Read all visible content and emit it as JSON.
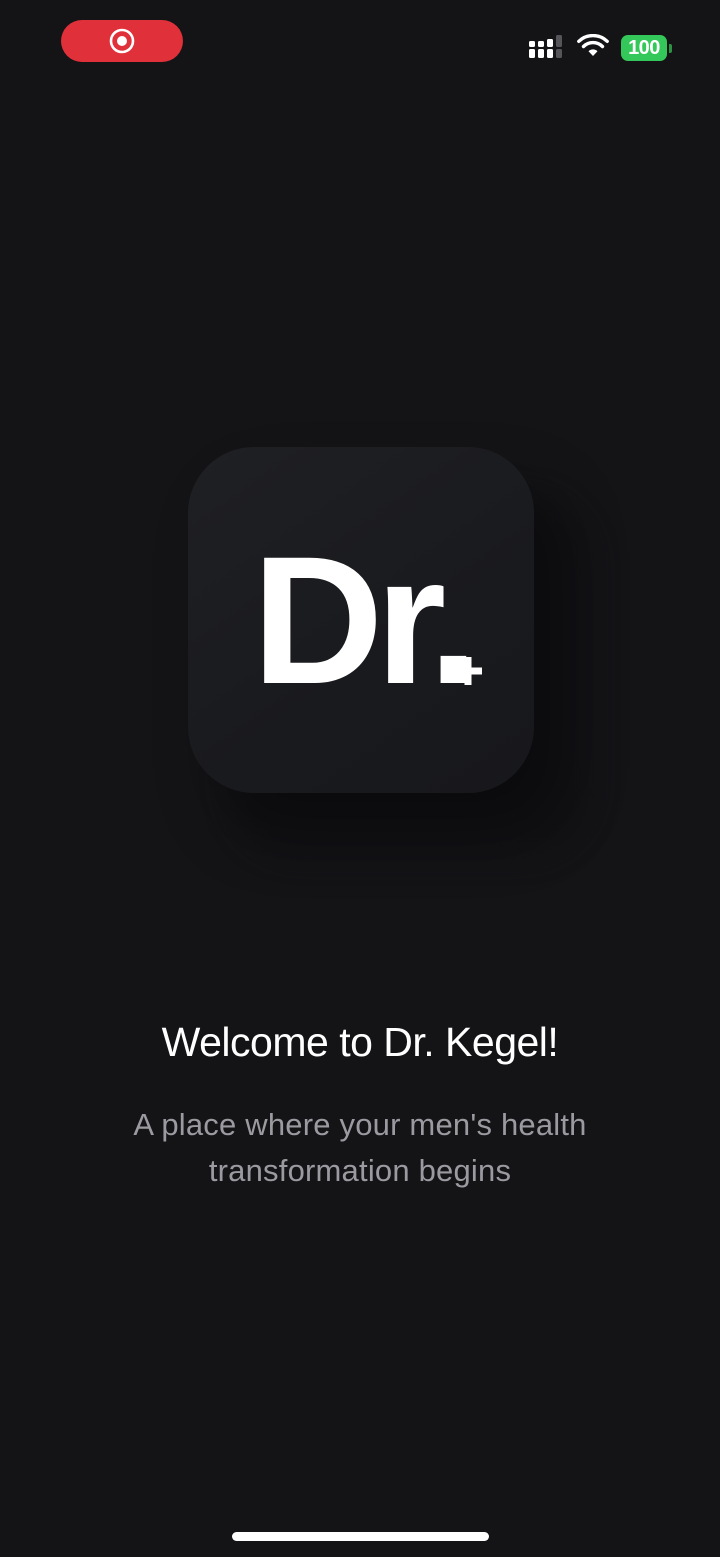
{
  "status_bar": {
    "battery_level": "100",
    "recording_color": "#e0303a",
    "battery_color": "#34c759",
    "icons": [
      "record-icon",
      "cellular-signal-icon",
      "wifi-icon",
      "battery-icon"
    ]
  },
  "logo": {
    "text": "Dr.",
    "badge": "+"
  },
  "welcome": {
    "title": "Welcome to Dr. Kegel!",
    "subtitle": "A place where your men's health transformation begins"
  },
  "colors": {
    "background": "#141417",
    "tile": "#1c1d21",
    "subtitle": "#9a9aa0"
  }
}
